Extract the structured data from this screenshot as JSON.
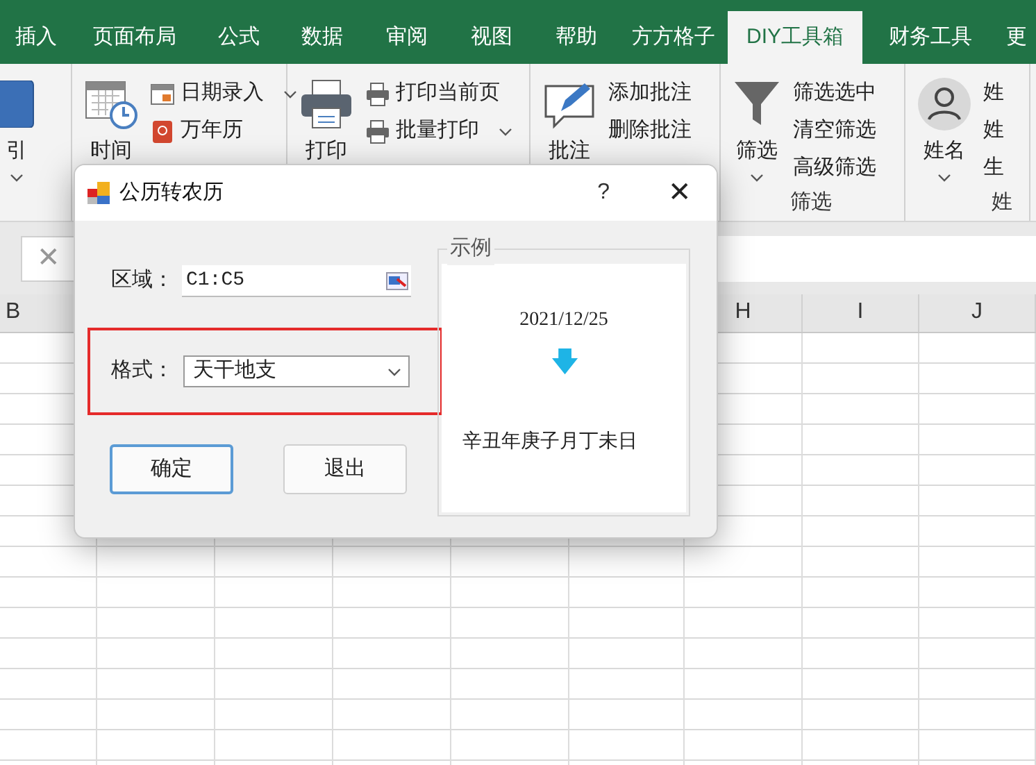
{
  "ribbon": {
    "tabs": [
      {
        "label": "插入",
        "selected": false
      },
      {
        "label": "页面布局",
        "selected": false
      },
      {
        "label": "公式",
        "selected": false
      },
      {
        "label": "数据",
        "selected": false
      },
      {
        "label": "审阅",
        "selected": false
      },
      {
        "label": "视图",
        "selected": false
      },
      {
        "label": "帮助",
        "selected": false
      },
      {
        "label": "方方格子",
        "selected": false
      },
      {
        "label": "DIY工具箱",
        "selected": true
      },
      {
        "label": "财务工具",
        "selected": false
      },
      {
        "label": "更",
        "selected": false
      }
    ],
    "groups": [
      {
        "large": {
          "label": "引",
          "dropdown": true
        }
      },
      {
        "large": {
          "label": "时间",
          "dropdown": false
        },
        "items": [
          {
            "label": "日期录入",
            "dropdown": true
          },
          {
            "label": "万年历",
            "dropdown": false
          }
        ]
      },
      {
        "large": {
          "label": "打印",
          "dropdown": false
        },
        "items": [
          {
            "label": "打印当前页",
            "dropdown": false
          },
          {
            "label": "批量打印",
            "dropdown": true
          }
        ]
      },
      {
        "large": {
          "label": "批注",
          "dropdown": false
        },
        "items": [
          {
            "label": "添加批注",
            "dropdown": false
          },
          {
            "label": "删除批注",
            "dropdown": false
          }
        ]
      },
      {
        "large": {
          "label": "筛选",
          "dropdown": true
        },
        "items": [
          {
            "label": "筛选选中",
            "dropdown": false
          },
          {
            "label": "清空筛选",
            "dropdown": false
          },
          {
            "label": "高级筛选",
            "dropdown": false
          }
        ],
        "label": "筛选"
      },
      {
        "large": {
          "label": "姓名",
          "dropdown": true
        },
        "items": [
          {
            "label": "姓",
            "dropdown": false
          },
          {
            "label": "姓",
            "dropdown": false
          },
          {
            "label": "生",
            "dropdown": false
          }
        ],
        "label": "姓"
      }
    ]
  },
  "formula_bar": {
    "cancel": "✕"
  },
  "sheet": {
    "columns": [
      "B",
      "H",
      "I",
      "J"
    ]
  },
  "dialog": {
    "title": "公历转农历",
    "help": "?",
    "close": "✕",
    "range": {
      "label": "区域：",
      "value": "C1:C5"
    },
    "format": {
      "label": "格式：",
      "value": "天干地支",
      "highlighted": true
    },
    "buttons": [
      {
        "label": "确定",
        "default": true
      },
      {
        "label": "退出",
        "default": false
      }
    ],
    "example": {
      "title": "示例",
      "input": "2021/12/25",
      "arrow": "🡇",
      "output": "辛丑年庚子月丁未日"
    }
  }
}
